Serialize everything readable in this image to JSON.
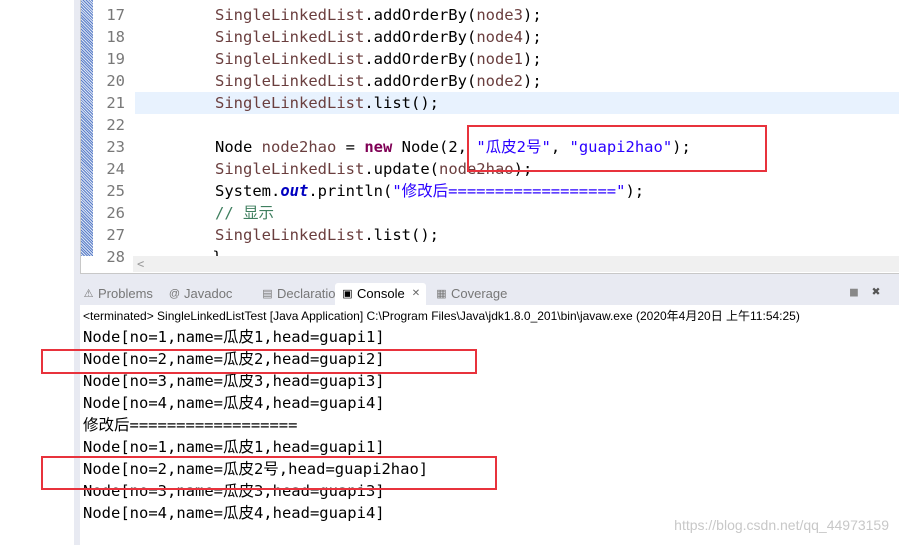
{
  "editor": {
    "lines": [
      {
        "n": "17",
        "parts": [
          [
            "cls",
            "SingleLinkedList"
          ],
          [
            "",
            "."
          ],
          [
            "",
            "addOrderBy("
          ],
          [
            "cls",
            "node3"
          ],
          [
            "",
            ");"
          ]
        ]
      },
      {
        "n": "18",
        "parts": [
          [
            "cls",
            "SingleLinkedList"
          ],
          [
            "",
            "."
          ],
          [
            "",
            "addOrderBy("
          ],
          [
            "cls",
            "node4"
          ],
          [
            "",
            ");"
          ]
        ]
      },
      {
        "n": "19",
        "parts": [
          [
            "cls",
            "SingleLinkedList"
          ],
          [
            "",
            "."
          ],
          [
            "",
            "addOrderBy("
          ],
          [
            "cls",
            "node1"
          ],
          [
            "",
            ");"
          ]
        ]
      },
      {
        "n": "20",
        "parts": [
          [
            "cls",
            "SingleLinkedList"
          ],
          [
            "",
            "."
          ],
          [
            "",
            "addOrderBy("
          ],
          [
            "cls",
            "node2"
          ],
          [
            "",
            ");"
          ]
        ]
      },
      {
        "n": "21",
        "parts": [
          [
            "cls",
            "SingleLinkedList"
          ],
          [
            "",
            "."
          ],
          [
            "",
            "list();"
          ]
        ]
      },
      {
        "n": "22",
        "parts": []
      },
      {
        "n": "23",
        "parts": [
          [
            "",
            "Node "
          ],
          [
            "cls",
            "node2hao"
          ],
          [
            "",
            " = "
          ],
          [
            "kw",
            "new"
          ],
          [
            "",
            " Node(2, "
          ],
          [
            "str",
            "\"瓜皮2号\""
          ],
          [
            "",
            ", "
          ],
          [
            "str",
            "\"guapi2hao\""
          ],
          [
            "",
            ");"
          ]
        ]
      },
      {
        "n": "24",
        "parts": [
          [
            "cls",
            "SingleLinkedList"
          ],
          [
            "",
            "."
          ],
          [
            "",
            "update("
          ],
          [
            "cls",
            "node2hao"
          ],
          [
            "",
            ");"
          ]
        ]
      },
      {
        "n": "25",
        "parts": [
          [
            "",
            "System."
          ],
          [
            "fld",
            "out"
          ],
          [
            "",
            ".println("
          ],
          [
            "str",
            "\"修改后==================\""
          ],
          [
            "",
            ");"
          ]
        ]
      },
      {
        "n": "26",
        "parts": [
          [
            "cm",
            "// 显示"
          ]
        ]
      },
      {
        "n": "27",
        "parts": [
          [
            "cls",
            "SingleLinkedList"
          ],
          [
            "",
            "."
          ],
          [
            "",
            "list();"
          ]
        ]
      },
      {
        "n": "28",
        "parts": [
          [
            "",
            "    }"
          ]
        ]
      }
    ],
    "current_line": "21"
  },
  "scroll_left": "<",
  "tabs": [
    {
      "label": "Problems",
      "icon": "problems-icon",
      "glyph": "⚠"
    },
    {
      "label": "Javadoc",
      "icon": "at-icon",
      "glyph": "@"
    },
    {
      "label": "Declaration",
      "icon": "declaration-icon",
      "glyph": "▤"
    },
    {
      "label": "Console",
      "icon": "console-icon",
      "glyph": "▣",
      "active": true,
      "close": "✕"
    },
    {
      "label": "Coverage",
      "icon": "coverage-icon",
      "glyph": "▦"
    }
  ],
  "toolbar": {
    "stop": "■",
    "remove": "✖"
  },
  "status": "<terminated> SingleLinkedListTest [Java Application] C:\\Program Files\\Java\\jdk1.8.0_201\\bin\\javaw.exe (2020年4月20日 上午11:54:25)",
  "console": [
    "Node[no=1,name=瓜皮1,head=guapi1]",
    "Node[no=2,name=瓜皮2,head=guapi2]",
    "Node[no=3,name=瓜皮3,head=guapi3]",
    "Node[no=4,name=瓜皮4,head=guapi4]",
    "修改后==================",
    "Node[no=1,name=瓜皮1,head=guapi1]",
    "Node[no=2,name=瓜皮2号,head=guapi2hao]",
    "Node[no=3,name=瓜皮3,head=guapi3]",
    "Node[no=4,name=瓜皮4,head=guapi4]"
  ],
  "watermark": "https://blog.csdn.net/qq_44973159",
  "colors": {
    "highlight": "#e8323c",
    "keyword": "#7f0055",
    "string": "#2a00ff"
  }
}
